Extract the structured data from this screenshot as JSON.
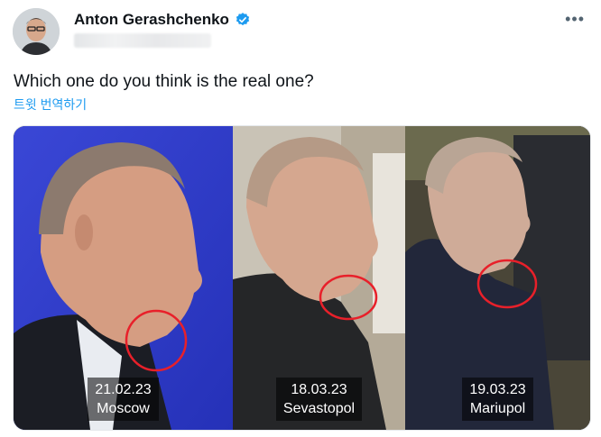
{
  "author": {
    "name": "Anton Gerashchenko",
    "verified": true
  },
  "tweet": {
    "text": "Which one do you think is the real one?",
    "translate_label": "트윗 번역하기"
  },
  "media": {
    "panels": [
      {
        "date": "21.02.23",
        "place": "Moscow"
      },
      {
        "date": "18.03.23",
        "place": "Sevastopol"
      },
      {
        "date": "19.03.23",
        "place": "Mariupol"
      }
    ]
  },
  "icons": {
    "verified": "verified-badge-icon",
    "more": "more-options-icon"
  },
  "colors": {
    "accent": "#1d9bf0",
    "highlight_circle": "#e8202a"
  }
}
